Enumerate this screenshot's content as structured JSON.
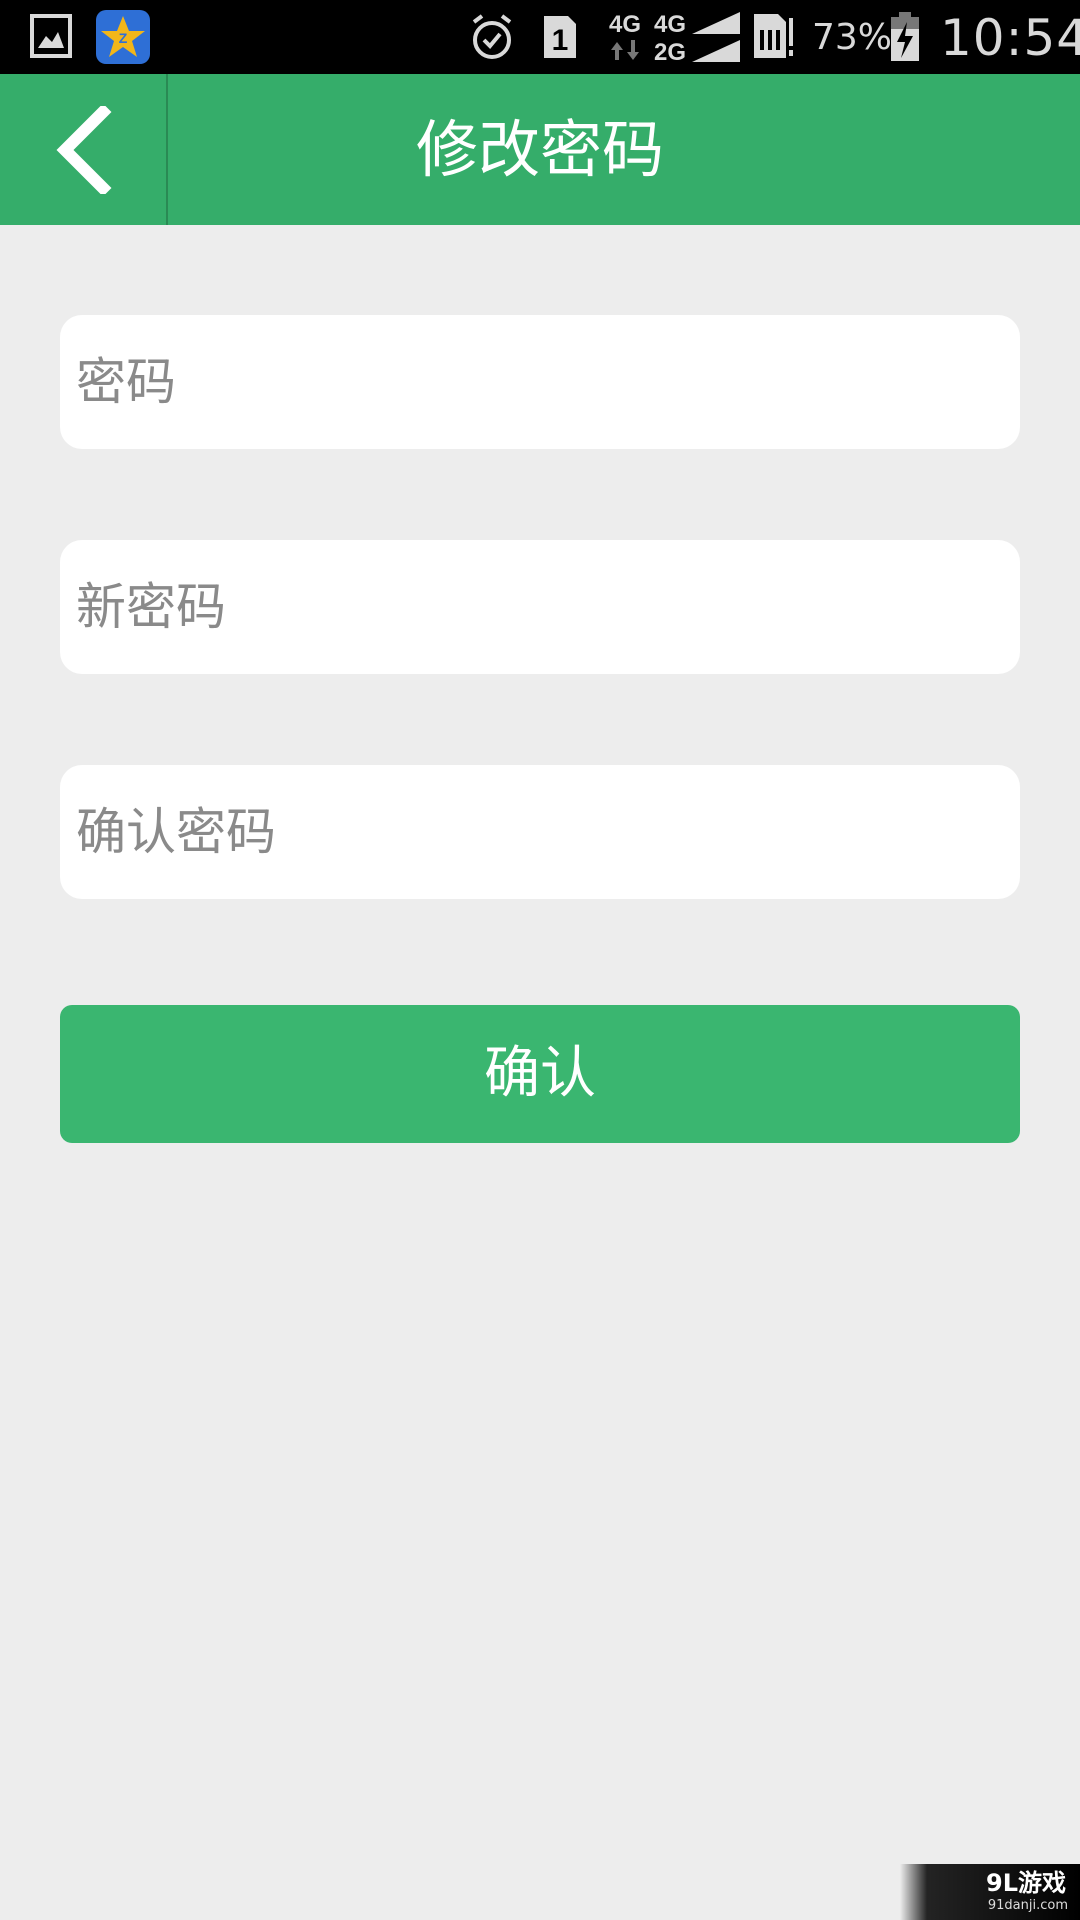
{
  "status_bar": {
    "left_icons": [
      "gallery-icon",
      "qzone-icon"
    ],
    "right_icons": [
      "alarm-icon",
      "sim1-icon",
      "network-4g-icon",
      "signal-4g-2g-icon",
      "sim-card-icon",
      "battery-charging-icon"
    ],
    "network_label_1": "4G",
    "network_label_2": "4G",
    "network_label_3": "2G",
    "sim_slot": "1",
    "battery_percent": "73%",
    "time": "10:54"
  },
  "header": {
    "title": "修改密码",
    "back_icon": "chevron-left-icon"
  },
  "form": {
    "password_placeholder": "密码",
    "new_password_placeholder": "新密码",
    "confirm_password_placeholder": "确认密码",
    "submit_label": "确认"
  },
  "watermark": {
    "logo_text": "9L游戏",
    "domain": "91danji.com"
  },
  "colors": {
    "header_bg": "#35ad6a",
    "button_bg": "#3ab670",
    "page_bg": "#ededed",
    "status_bar_bg": "#000000"
  }
}
